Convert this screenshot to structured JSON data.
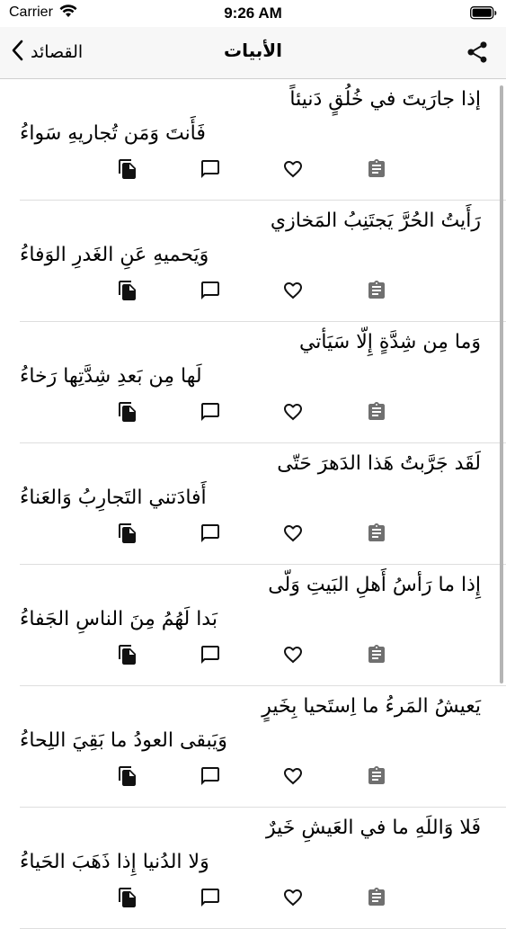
{
  "status_bar": {
    "carrier": "Carrier",
    "time": "9:26 AM"
  },
  "nav": {
    "back_label": "القصائد",
    "title": "الأبيات"
  },
  "verses": [
    {
      "line1": "إذا جارَيتَ في خُلُقٍ دَنيئاً",
      "line2": "فَأَنتَ وَمَن تُجاريهِ سَواءُ"
    },
    {
      "line1": "رَأَيتُ الحُرَّ يَجتَنِبُ المَخازي",
      "line2": "وَيَحميهِ عَنِ الغَدرِ الوَفاءُ"
    },
    {
      "line1": "وَما مِن شِدَّةٍ إِلّا سَيَأتي",
      "line2": "لَها مِن بَعدِ شِدَّتِها رَخاءُ"
    },
    {
      "line1": "لَقَد جَرَّبتُ هَذا الدَهرَ حَتّى",
      "line2": "أَفادَتني التَجارِبُ وَالعَناءُ"
    },
    {
      "line1": "إِذا ما رَأسُ أَهلِ البَيتِ وَلّى",
      "line2": "بَدا لَهُمُ مِنَ الناسِ الجَفاءُ"
    },
    {
      "line1": "يَعيشُ المَرءُ ما اِستَحيا بِخَيرٍ",
      "line2": "وَيَبقى العودُ ما بَقِيَ اللِحاءُ"
    },
    {
      "line1": "فَلا وَاللَهِ ما في العَيشِ خَيرٌ",
      "line2": "وَلا الدُنيا إِذا ذَهَبَ الحَياءُ"
    }
  ],
  "icons": {
    "copy": "copy-icon",
    "comment": "comment-icon",
    "favorite": "heart-outline-icon",
    "clipboard": "clipboard-icon",
    "share": "share-icon",
    "back": "chevron-left-icon"
  },
  "colors": {
    "icon_dark": "#111111",
    "icon_gray": "#707070",
    "nav_bg": "#f7f7f7"
  }
}
